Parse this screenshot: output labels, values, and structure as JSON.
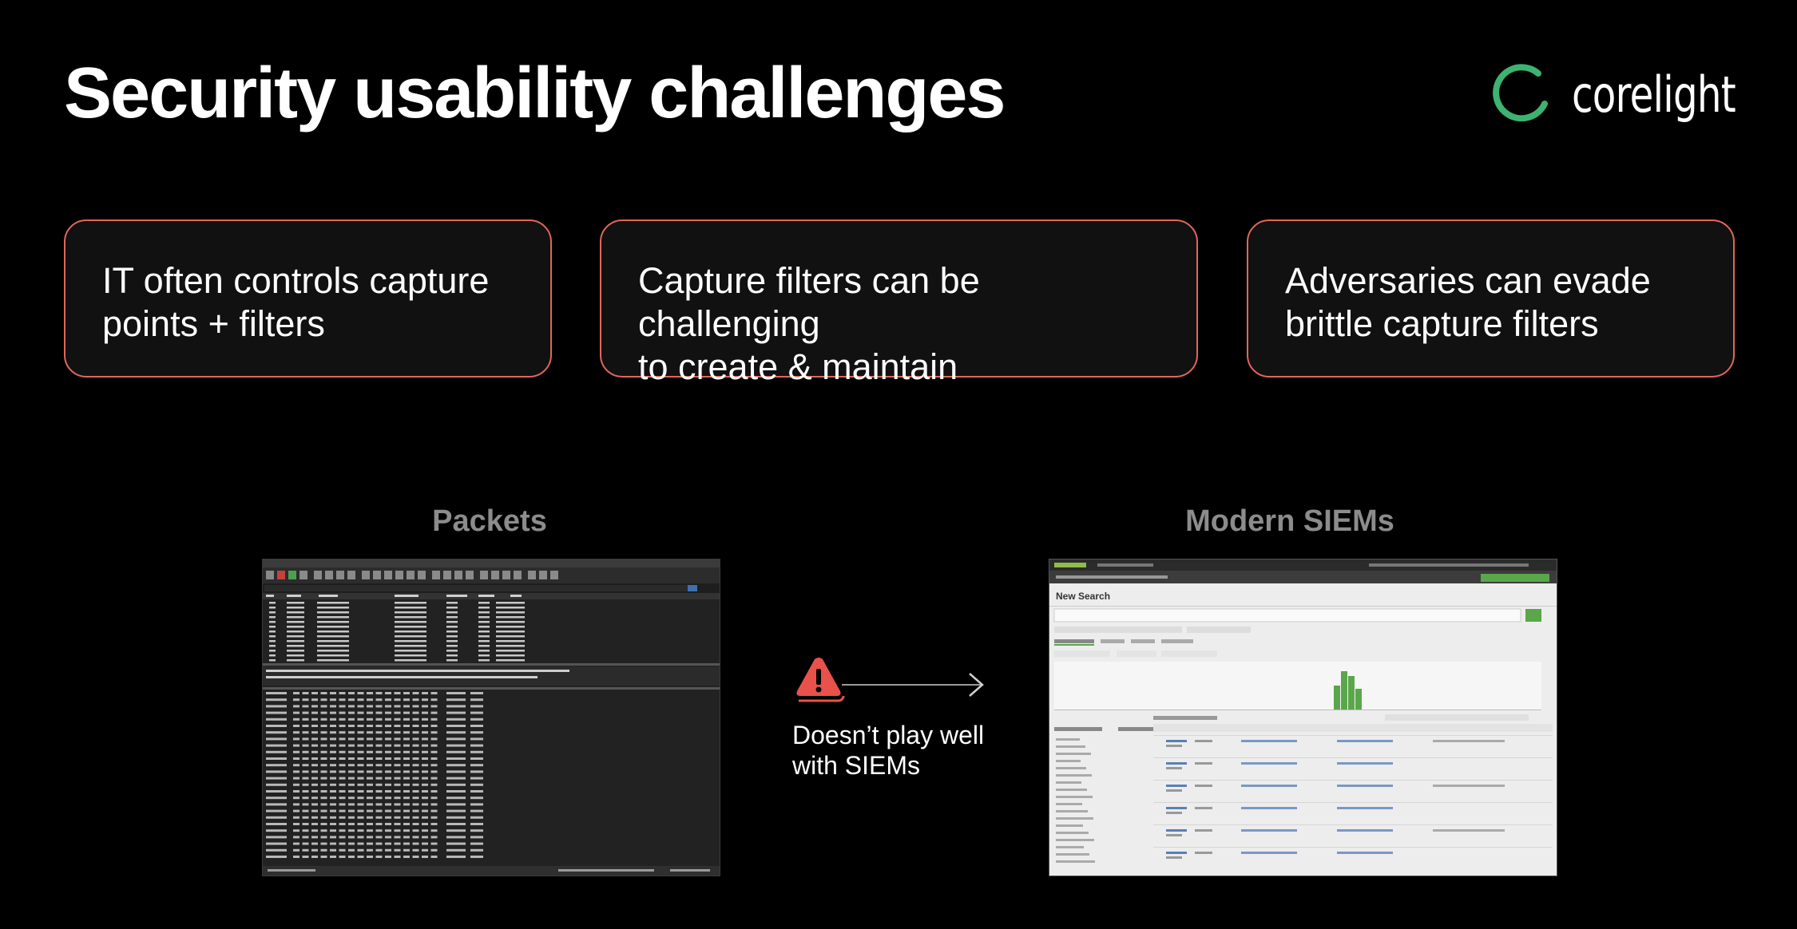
{
  "slide": {
    "title": "Security usability challenges",
    "logo_text": "corelight"
  },
  "cards": [
    {
      "line1": "IT often controls capture",
      "line2": "points + filters"
    },
    {
      "line1": "Capture filters can be challenging",
      "line2": "to create & maintain"
    },
    {
      "line1": "Adversaries can evade",
      "line2": "brittle capture filters"
    }
  ],
  "diagram": {
    "left_label": "Packets",
    "right_label": "Modern SIEMs",
    "caption_line1": "Doesn’t play well",
    "caption_line2": "with SIEMs"
  },
  "siem_ui": {
    "header_title": "New Search"
  },
  "colors": {
    "background": "#000000",
    "card_border": "#e2665b",
    "card_fill": "#111111",
    "logo_green": "#3cb371",
    "warning_red": "#e8524a",
    "label_gray": "#8c8c8c"
  },
  "icons": [
    "corelight-logo-icon",
    "warning-icon",
    "arrow-right-icon"
  ]
}
